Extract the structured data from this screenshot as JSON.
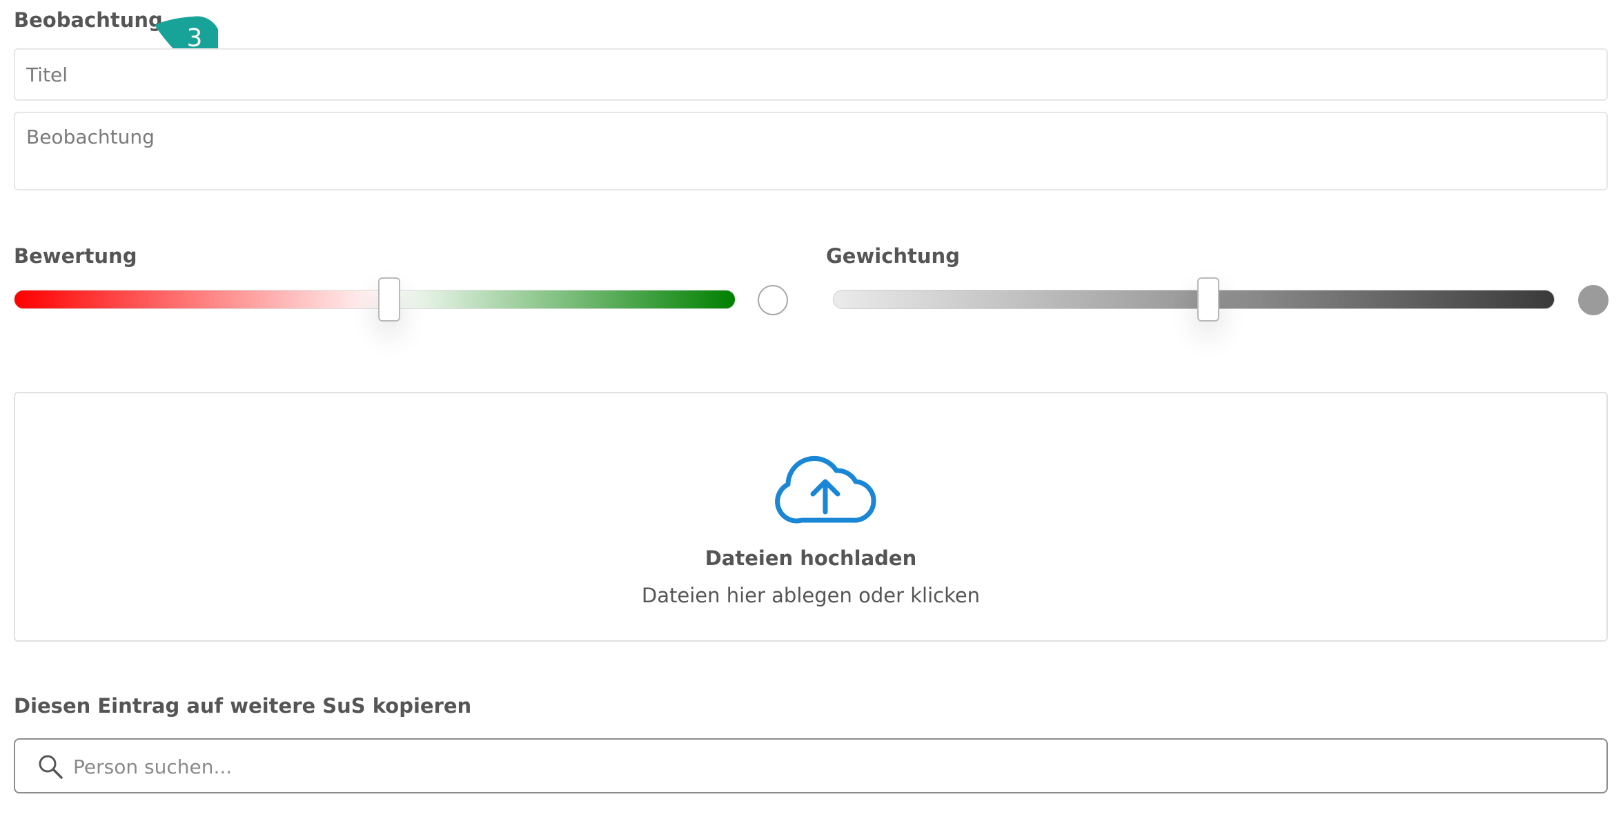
{
  "observation": {
    "section_label": "Beobachtung",
    "step_badge": "3",
    "title_placeholder": "Titel",
    "text_placeholder": "Beobachtung"
  },
  "rating": {
    "label": "Bewertung",
    "value_fraction": 0.52
  },
  "weight": {
    "label": "Gewichtung",
    "value_fraction": 0.52
  },
  "upload": {
    "title": "Dateien hochladen",
    "subtitle": "Dateien hier ablegen oder klicken"
  },
  "copy": {
    "label": "Diesen Eintrag auf weitere SuS kopieren",
    "search_placeholder": "Person suchen..."
  },
  "colors": {
    "badge": "#17a398",
    "upload_icon": "#1a86d6"
  }
}
